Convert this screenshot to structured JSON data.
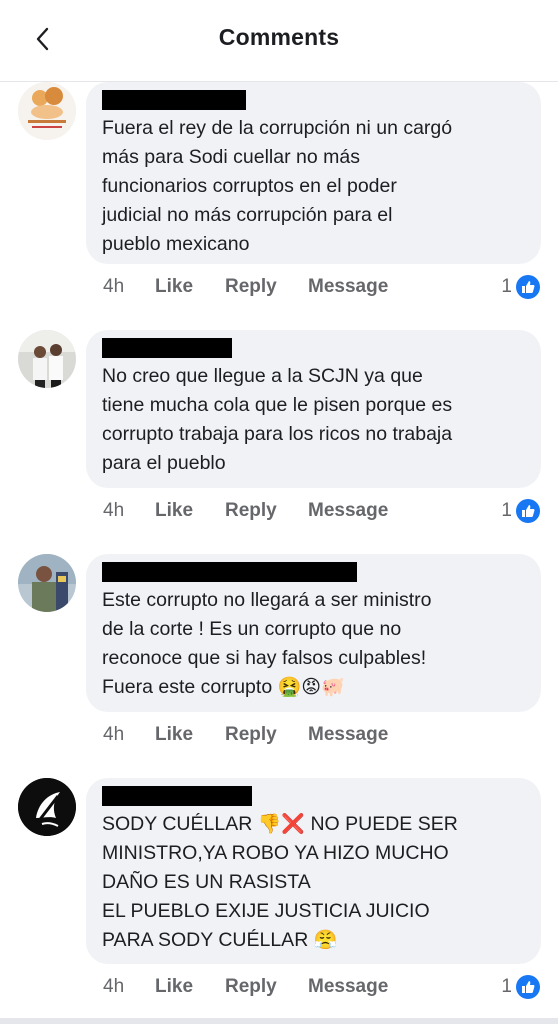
{
  "header": {
    "title": "Comments",
    "back_icon": "chevron-left-icon"
  },
  "colors": {
    "bubble": "#f0f2f5",
    "like": "#1877f2",
    "meta": "#65676b"
  },
  "comments": [
    {
      "text": "Fuera el rey de la corrupción ni un cargó\nmás para Sodi cuellar no más\nfuncionarios corruptos en el poder\njudicial no más corrupción para el\npueblo mexicano",
      "time": "4h",
      "like": "Like",
      "reply": "Reply",
      "message": "Message",
      "reactions": "1"
    },
    {
      "text": "No creo que llegue a la SCJN ya que\ntiene mucha cola que le pisen porque es\ncorrupto trabaja para los ricos no trabaja\npara el pueblo",
      "time": "4h",
      "like": "Like",
      "reply": "Reply",
      "message": "Message",
      "reactions": "1"
    },
    {
      "text": "Este corrupto  no llegará a ser ministro\nde la corte ! Es un corrupto que no\nreconoce que si hay falsos culpables!\nFuera este corrupto ",
      "emojis": "🤮😡🐖",
      "time": "4h",
      "like": "Like",
      "reply": "Reply",
      "message": "Message"
    },
    {
      "text": "SODY CUÉLLAR ",
      "emojis_a": "👎❌",
      "text_b": " NO PUEDE SER\nMINISTRO,YA ROBO YA HIZO MUCHO\nDAÑO ES UN RASISTA\nEL PUEBLO EXIJE JUSTICIA JUICIO\nPARA SODY CUÉLLAR ",
      "emojis_b": "😤",
      "time": "4h",
      "like": "Like",
      "reply": "Reply",
      "message": "Message",
      "reactions": "1"
    }
  ]
}
